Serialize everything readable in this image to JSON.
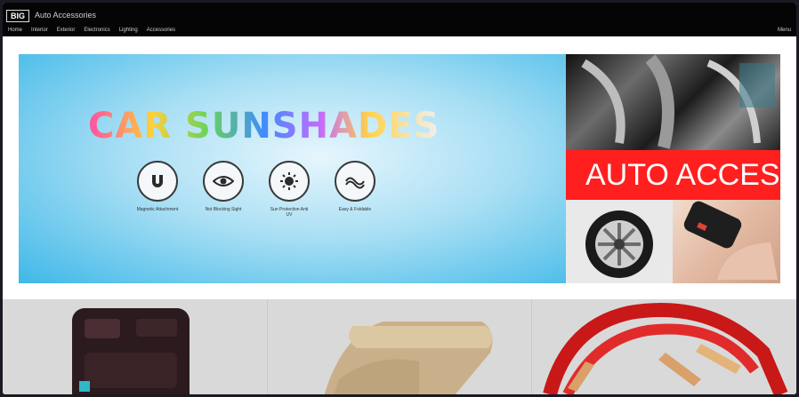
{
  "header": {
    "logo": "BIG",
    "site_name": "Auto Accessories",
    "nav": [
      "Home",
      "Interior",
      "Exterior",
      "Electronics",
      "Lighting",
      "Accessories"
    ],
    "right_link": "Menu"
  },
  "banner": {
    "title": "CAR SUNSHADES",
    "features": [
      {
        "icon": "magnet-icon",
        "label": "Magnetic Attachment"
      },
      {
        "icon": "eye-icon",
        "label": "Not Blocking Sight"
      },
      {
        "icon": "sun-icon",
        "label": "Sun Protection Anti UV"
      },
      {
        "icon": "foldable-icon",
        "label": "Easy & Foldable"
      }
    ],
    "promo_text": "AUTO ACCES"
  },
  "products": [
    {
      "name": "seat-back-organizer"
    },
    {
      "name": "armrest-cushion"
    },
    {
      "name": "jumper-cables"
    }
  ],
  "colors": {
    "header_bg": "#050505",
    "banner_blue": "#3fb8e8",
    "promo_red": "#ff1f1f",
    "product_bg": "#d9d9d9"
  }
}
